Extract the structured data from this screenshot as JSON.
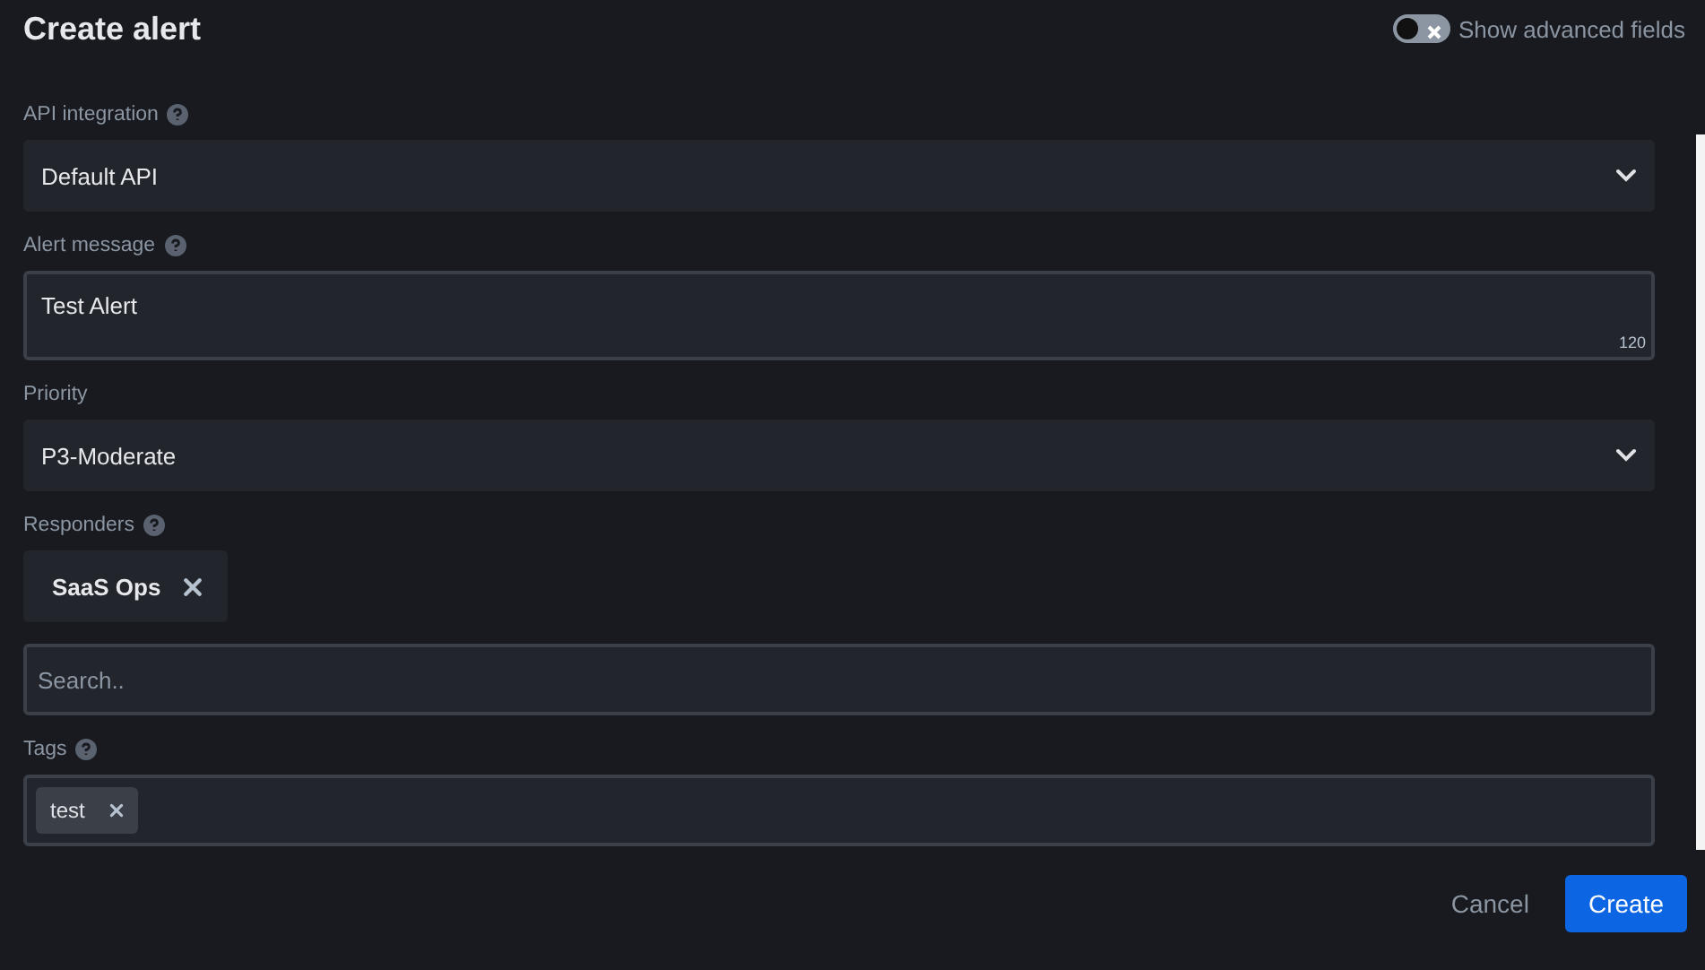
{
  "title": "Create alert",
  "advanced_toggle": {
    "label": "Show advanced fields",
    "on": false
  },
  "fields": [
    {
      "kind": "select",
      "label": "API integration",
      "help": true,
      "value": "Default API"
    },
    {
      "kind": "textarea",
      "label": "Alert message",
      "help": true,
      "value": "Test Alert",
      "counter": "120"
    },
    {
      "kind": "select",
      "label": "Priority",
      "help": false,
      "value": "P3-Moderate"
    },
    {
      "kind": "responders",
      "label": "Responders",
      "help": true,
      "chips": [
        "SaaS Ops"
      ],
      "placeholder": "Search.."
    },
    {
      "kind": "tags",
      "label": "Tags",
      "help": true,
      "chips": [
        "test"
      ]
    }
  ],
  "buttons": [
    {
      "kind": "link",
      "label": "Cancel"
    },
    {
      "kind": "primary",
      "label": "Create"
    }
  ]
}
